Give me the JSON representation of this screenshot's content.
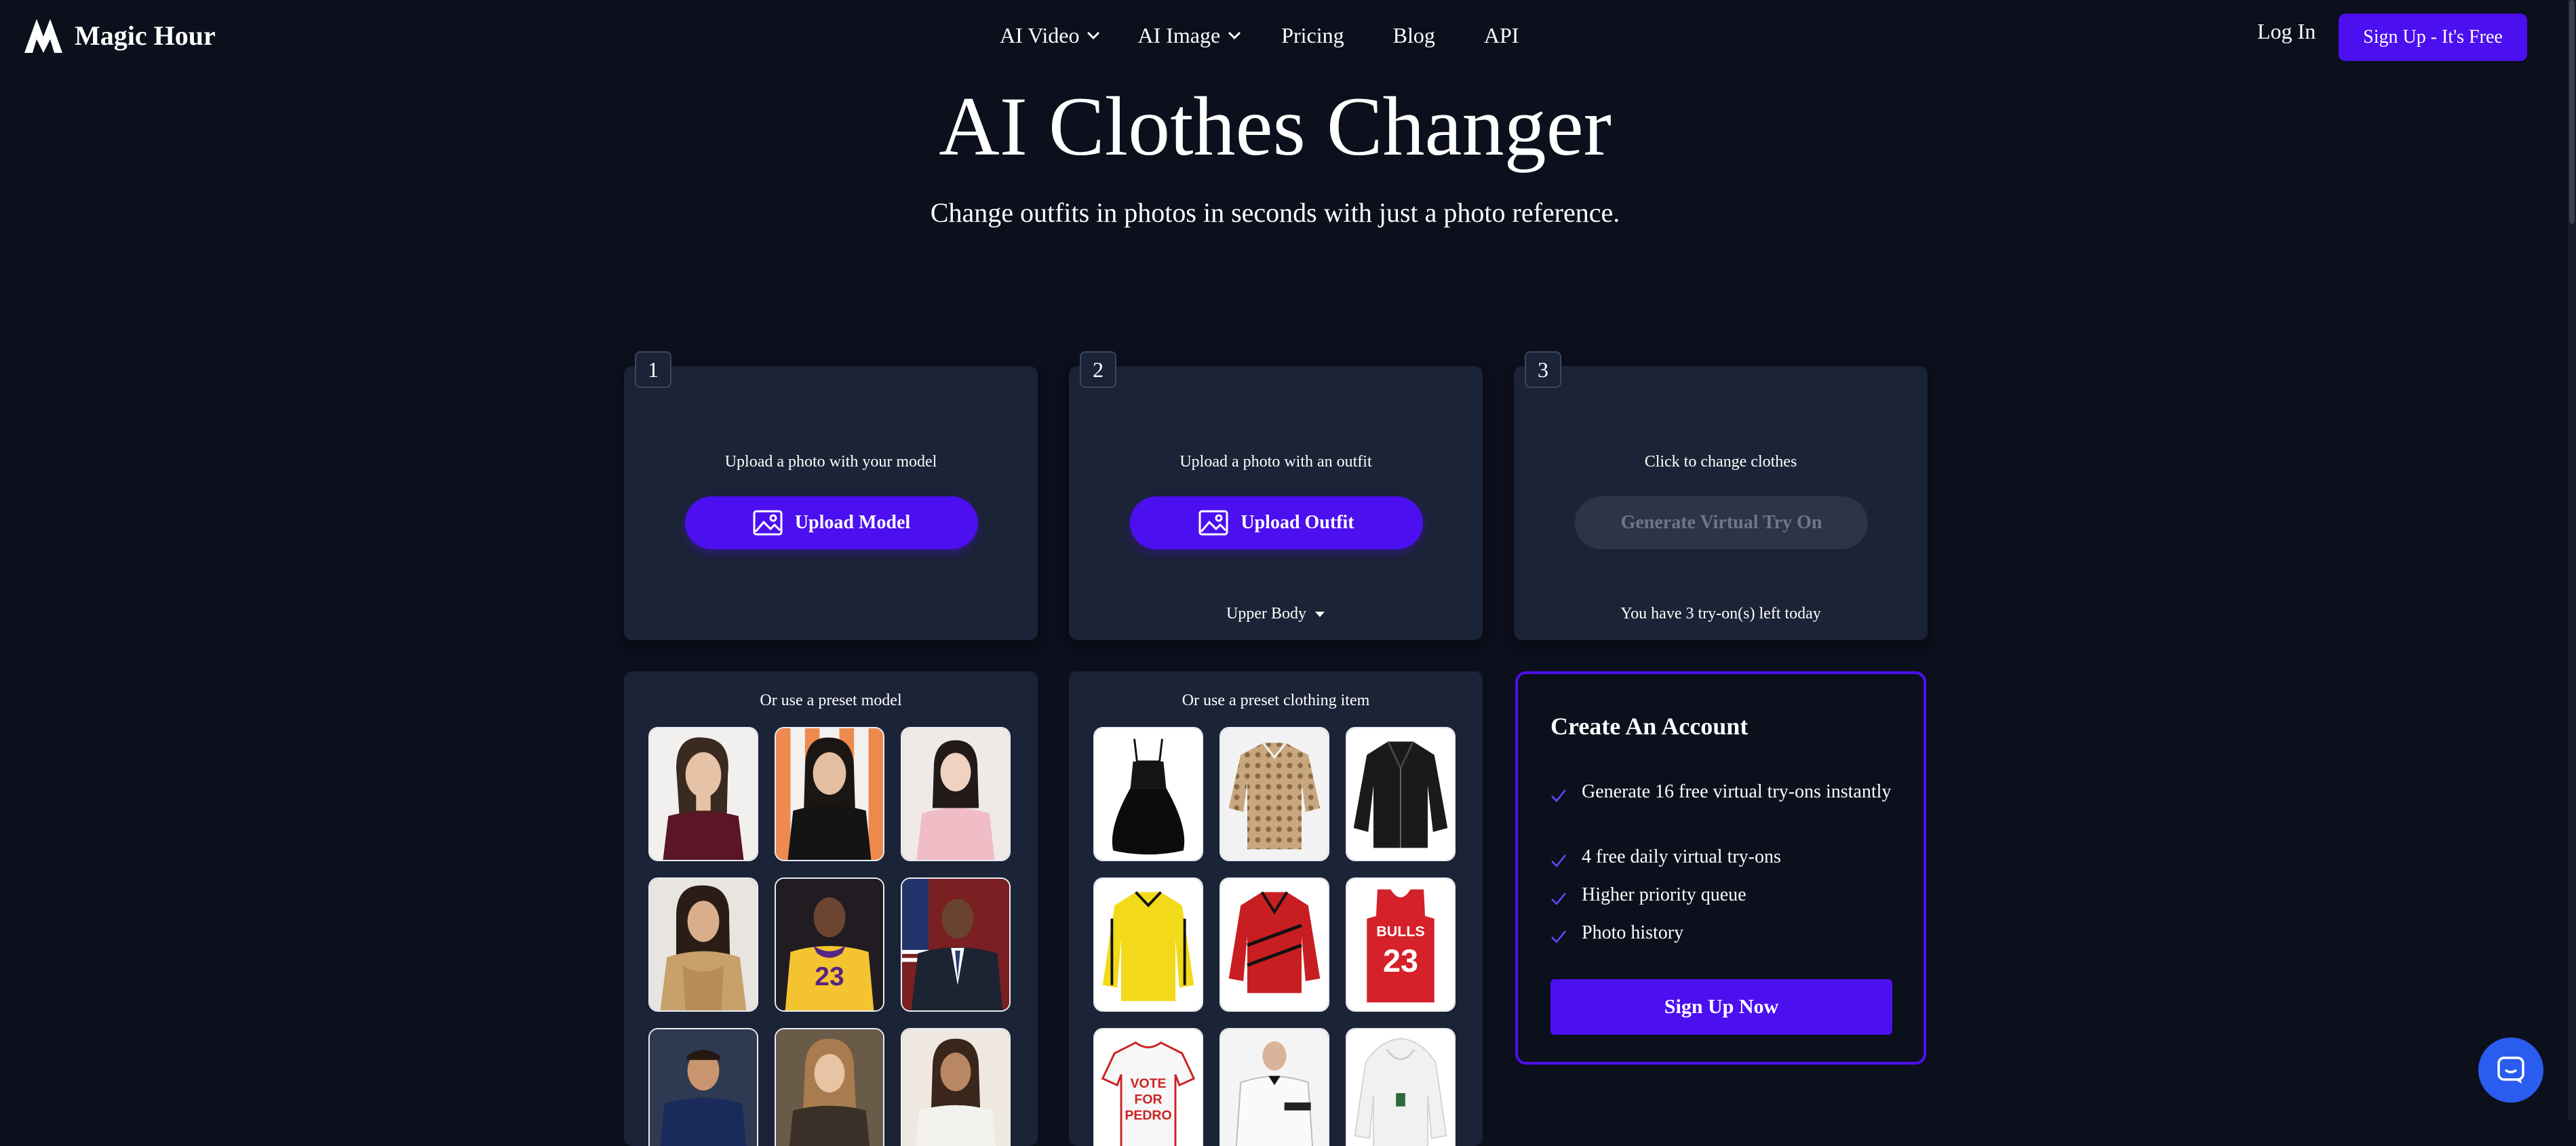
{
  "header": {
    "brand": "Magic Hour",
    "nav": [
      {
        "label": "AI Video",
        "dropdown": true
      },
      {
        "label": "AI Image",
        "dropdown": true
      },
      {
        "label": "Pricing",
        "dropdown": false
      },
      {
        "label": "Blog",
        "dropdown": false
      },
      {
        "label": "API",
        "dropdown": false
      }
    ],
    "login": "Log In",
    "signup": "Sign Up  - It's Free"
  },
  "hero": {
    "title": "AI Clothes Changer",
    "subtitle": "Change outfits in photos in seconds with just a photo reference."
  },
  "steps": [
    {
      "number": "1",
      "label": "Upload a photo with your model",
      "button": "Upload Model",
      "footer": ""
    },
    {
      "number": "2",
      "label": "Upload a photo with an outfit",
      "button": "Upload Outfit",
      "footer": "Upper Body"
    },
    {
      "number": "3",
      "label": "Click to change clothes",
      "button": "Generate Virtual Try On",
      "footer": "You have 3 try-on(s) left today"
    }
  ],
  "presets": {
    "model_title": "Or use a preset model",
    "clothing_title": "Or use a preset clothing item",
    "shirt_text": "VOTE FOR PEDRO",
    "jersey_text": "BULLS 23"
  },
  "account": {
    "title": "Create An Account",
    "benefits": [
      "Generate 16 free virtual try-ons instantly",
      "4 free daily virtual try-ons",
      "Higher priority queue",
      "Photo history"
    ],
    "button": "Sign Up Now"
  },
  "colors": {
    "background": "#0c0f1c",
    "card": "#1b2336",
    "accent": "#4c0ff0",
    "chat": "#2a5cf0"
  },
  "icons": [
    "magic-hour-logo-icon",
    "chevron-down-icon",
    "image-icon",
    "caret-down-icon",
    "check-icon",
    "chat-icon"
  ]
}
